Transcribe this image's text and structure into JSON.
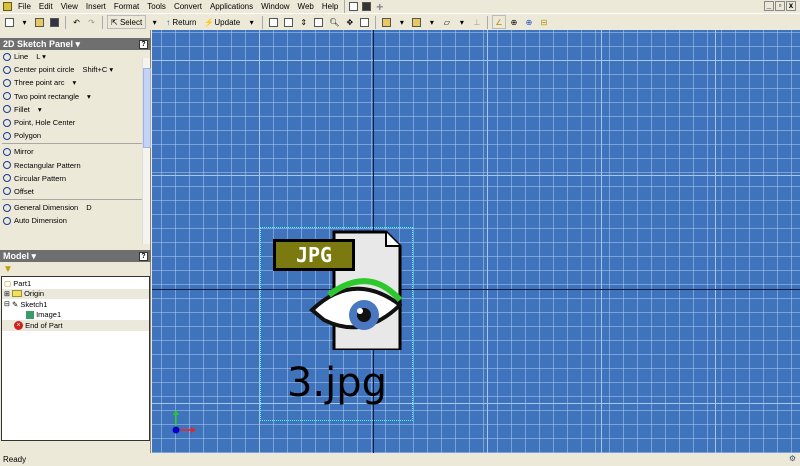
{
  "menu": [
    "File",
    "Edit",
    "View",
    "Insert",
    "Format",
    "Tools",
    "Convert",
    "Applications",
    "Window",
    "Web",
    "Help"
  ],
  "toolbar": {
    "select": "Select",
    "return": "Return",
    "update": "Update"
  },
  "sketch_panel": {
    "title": "2D Sketch Panel ▾",
    "groups": [
      [
        {
          "label": "Line",
          "shortcut": "L ▾"
        },
        {
          "label": "Center point circle",
          "shortcut": "Shift+C ▾"
        },
        {
          "label": "Three point arc",
          "shortcut": "▾"
        },
        {
          "label": "Two point rectangle",
          "shortcut": "▾"
        },
        {
          "label": "Fillet",
          "shortcut": "▾"
        },
        {
          "label": "Point, Hole Center",
          "shortcut": ""
        },
        {
          "label": "Polygon",
          "shortcut": ""
        }
      ],
      [
        {
          "label": "Mirror",
          "shortcut": ""
        },
        {
          "label": "Rectangular Pattern",
          "shortcut": ""
        },
        {
          "label": "Circular Pattern",
          "shortcut": ""
        },
        {
          "label": "Offset",
          "shortcut": ""
        }
      ],
      [
        {
          "label": "General Dimension",
          "shortcut": "D"
        },
        {
          "label": "Auto Dimension",
          "shortcut": ""
        }
      ]
    ]
  },
  "model": {
    "title": "Model ▾",
    "tree": [
      "Part1",
      "Origin",
      "Sketch1",
      "Image1",
      "End of Part"
    ]
  },
  "canvas": {
    "file_badge": "JPG",
    "caption": "3.jpg"
  },
  "status": "Ready"
}
